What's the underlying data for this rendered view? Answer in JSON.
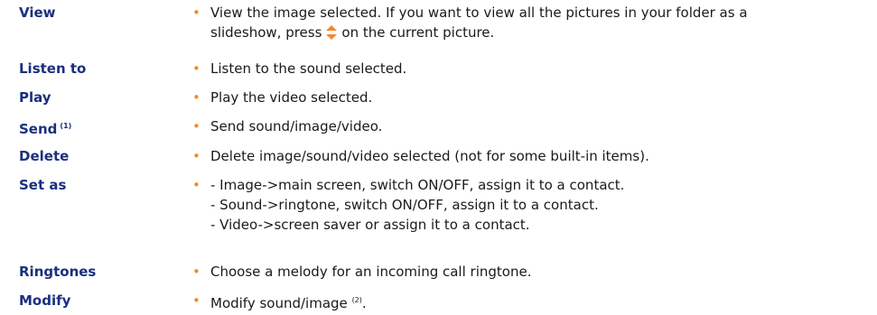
{
  "colors": {
    "term": "#1a2f80",
    "bullet": "#f28a2c",
    "text": "#1a1a1a"
  },
  "items": [
    {
      "term": "View",
      "lines": [
        "View the image selected. If you want to view all the pictures in your folder as a",
        "slideshow, press",
        "on the current picture."
      ],
      "icon": "up-down-arrow-icon"
    },
    {
      "term": "Listen to",
      "lines": [
        "Listen to the sound selected."
      ]
    },
    {
      "term": "Play",
      "lines": [
        "Play the video selected."
      ]
    },
    {
      "term": "Send",
      "term_note": "(1)",
      "lines": [
        "Send sound/image/video."
      ]
    },
    {
      "term": "Delete",
      "lines": [
        "Delete image/sound/video selected (not for some built-in items)."
      ]
    },
    {
      "term": "Set as",
      "lines": [
        "- Image->main screen, switch ON/OFF, assign it to a contact.",
        "- Sound->ringtone, switch ON/OFF, assign it to a contact.",
        "- Video->screen saver or assign it to a contact."
      ]
    },
    {
      "term": "Ringtones",
      "lines": [
        "Choose a melody for an incoming call ringtone."
      ]
    },
    {
      "term": "Modify",
      "lines": [
        "Modify sound/image",
        "(2)",
        "."
      ]
    }
  ]
}
